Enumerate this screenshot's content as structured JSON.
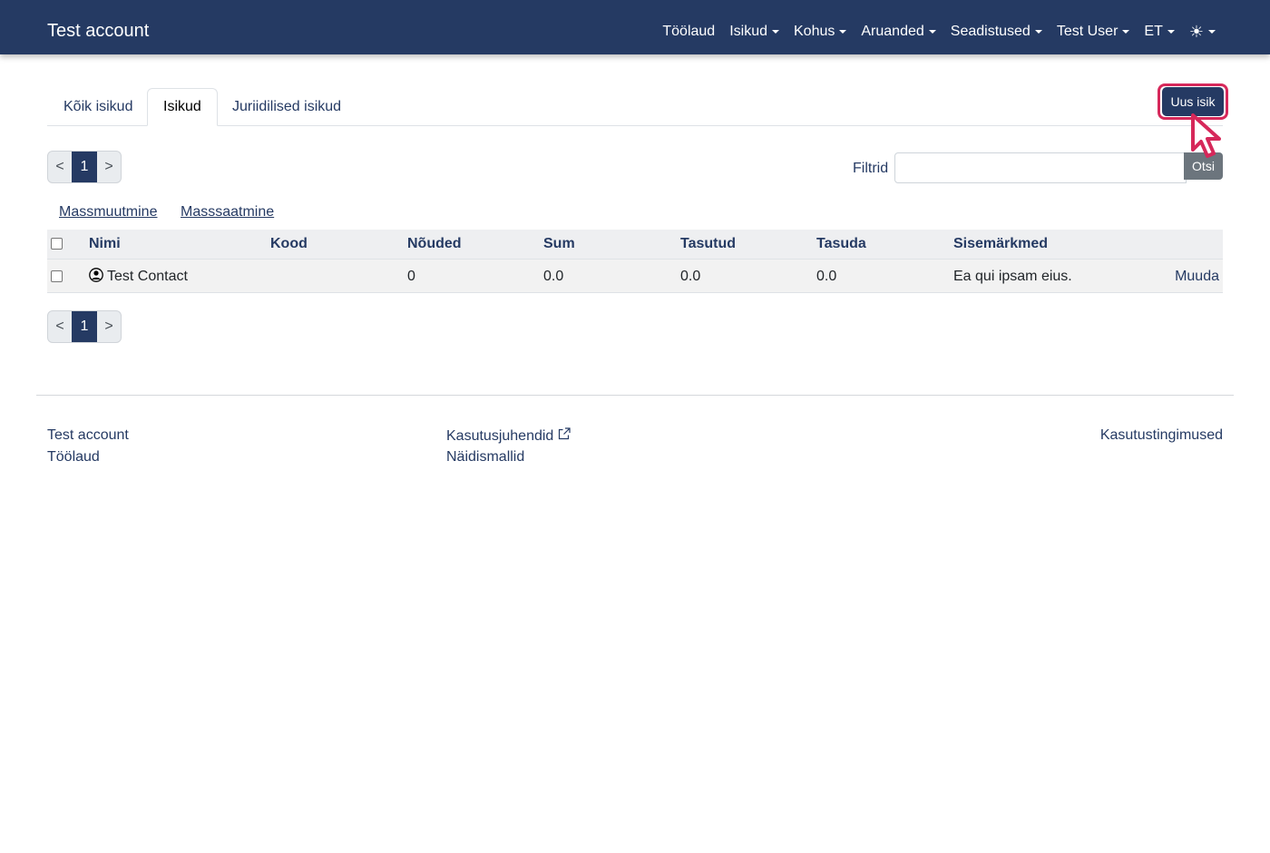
{
  "navbar": {
    "brand": "Test account",
    "items": [
      {
        "label": "Töölaud",
        "dropdown": false
      },
      {
        "label": "Isikud",
        "dropdown": true
      },
      {
        "label": "Kohus",
        "dropdown": true
      },
      {
        "label": "Aruanded",
        "dropdown": true
      },
      {
        "label": "Seadistused",
        "dropdown": true
      },
      {
        "label": "Test User",
        "dropdown": true
      },
      {
        "label": "ET",
        "dropdown": true
      }
    ],
    "theme_icon": "sun-icon"
  },
  "tabs": [
    {
      "label": "Kõik isikud",
      "active": false
    },
    {
      "label": "Isikud",
      "active": true
    },
    {
      "label": "Juriidilised isikud",
      "active": false
    }
  ],
  "new_button": {
    "label": "Uus isik"
  },
  "pagination": {
    "prev": "<",
    "current": "1",
    "next": ">"
  },
  "filter": {
    "label": "Filtrid",
    "value": "",
    "placeholder": "",
    "button": "Otsi"
  },
  "mass_actions": {
    "edit": "Massmuutmine",
    "send": "Masssaatmine"
  },
  "table": {
    "headers": [
      "Nimi",
      "Kood",
      "Nõuded",
      "Sum",
      "Tasutud",
      "Tasuda",
      "Sisemärkmed"
    ],
    "rows": [
      {
        "name": "Test Contact",
        "code": "",
        "claims": "0",
        "sum": "0.0",
        "paid": "0.0",
        "due": "0.0",
        "notes": "Ea qui ipsam eius.",
        "action": "Muuda"
      }
    ]
  },
  "footer": {
    "col1": [
      "Test account",
      "Töölaud"
    ],
    "col2": [
      "Kasutusjuhendid",
      "Näidismallid"
    ],
    "col3": [
      "Kasutustingimused"
    ]
  },
  "colors": {
    "primary": "#253a63",
    "highlight": "#d6285a",
    "secondary": "#6c757d"
  }
}
